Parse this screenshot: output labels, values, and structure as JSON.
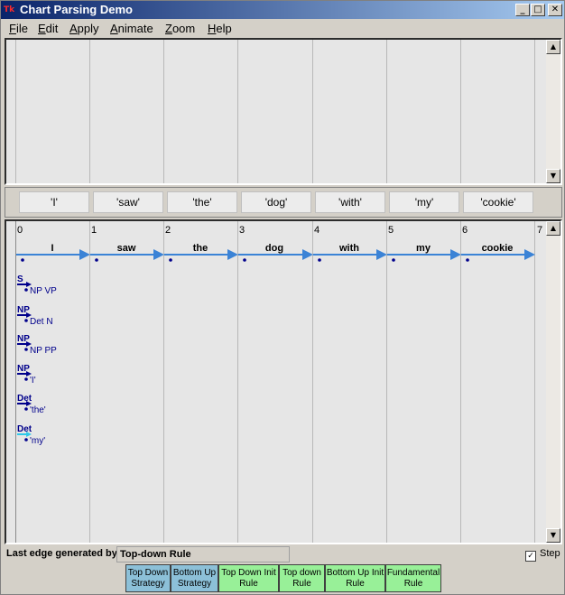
{
  "window": {
    "title": "Chart Parsing Demo",
    "icon": "tk-feather-icon"
  },
  "window_controls": {
    "minimize": "_",
    "maximize": "□",
    "close": "✕"
  },
  "menu": [
    "File",
    "Edit",
    "Apply",
    "Animate",
    "Zoom",
    "Help"
  ],
  "tokens": [
    "'I'",
    "'saw'",
    "'the'",
    "'dog'",
    "'with'",
    "'my'",
    "'cookie'"
  ],
  "chart": {
    "positions": [
      "0",
      "1",
      "2",
      "3",
      "4",
      "5",
      "6",
      "7"
    ],
    "words": [
      "I",
      "saw",
      "the",
      "dog",
      "with",
      "my",
      "cookie"
    ],
    "edges": [
      {
        "lhs": "S",
        "rhs": "NP VP"
      },
      {
        "lhs": "NP",
        "rhs": "Det N"
      },
      {
        "lhs": "NP",
        "rhs": "NP PP"
      },
      {
        "lhs": "NP",
        "rhs": "'I'"
      },
      {
        "lhs": "Det",
        "rhs": "'the'"
      },
      {
        "lhs": "Det",
        "rhs": "'my'"
      }
    ]
  },
  "status": {
    "label": "Last edge generated by:",
    "value": "Top-down Rule",
    "step_label": "Step",
    "step_checked": true
  },
  "actions": [
    {
      "line1": "Top Down",
      "line2": "Strategy"
    },
    {
      "line1": "Bottom Up",
      "line2": "Strategy"
    },
    {
      "line1": "Top Down Init",
      "line2": "Rule"
    },
    {
      "line1": "Top down",
      "line2": "Rule"
    },
    {
      "line1": "Bottom Up Init",
      "line2": "Rule"
    },
    {
      "line1": "Fundamental",
      "line2": "Rule"
    }
  ],
  "colors": {
    "leaf_arrow": "#3b83d6",
    "edge_arrow": "#00008b",
    "selected_edge": "#2ec8e8",
    "strategy_btn": "#8cc0d8",
    "rule_btn": "#98f098"
  }
}
